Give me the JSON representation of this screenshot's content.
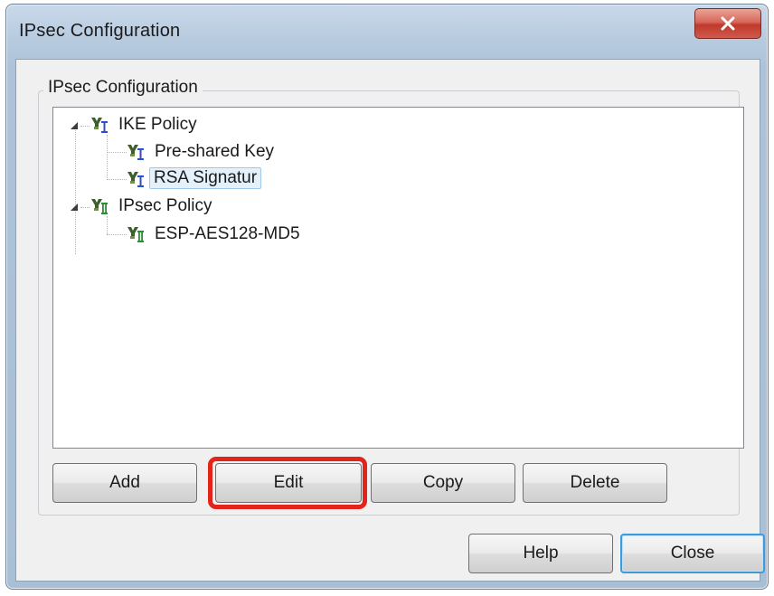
{
  "window": {
    "title": "IPsec Configuration",
    "close_glyph": "✕"
  },
  "group": {
    "label": "IPsec Configuration"
  },
  "tree": {
    "nodes": [
      {
        "label": "IKE Policy",
        "icon": "ike-policy-icon",
        "expanded": true
      },
      {
        "label": "Pre-shared Key",
        "icon": "ike-policy-icon"
      },
      {
        "label": "RSA Signatur",
        "icon": "ike-policy-icon",
        "selected": true
      },
      {
        "label": "IPsec Policy",
        "icon": "ipsec-policy-icon",
        "expanded": true
      },
      {
        "label": "ESP-AES128-MD5",
        "icon": "ipsec-policy-icon"
      }
    ]
  },
  "buttons": {
    "add": "Add",
    "edit": "Edit",
    "copy": "Copy",
    "delete": "Delete",
    "help": "Help",
    "close": "Close"
  },
  "colors": {
    "highlight": "#e2241b",
    "ike_icon_accent": "#2f4fc9",
    "ipsec_icon_accent": "#2e8b3a",
    "focus_border": "#3c9bd8"
  }
}
